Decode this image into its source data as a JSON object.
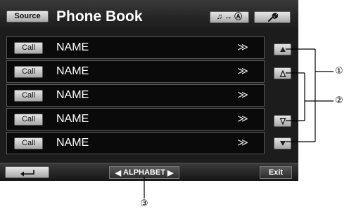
{
  "header": {
    "source_label": "Source",
    "title": "Phone Book",
    "media_label": "♫ ↔ Ⓐ",
    "setup_icon": "wrench-icon"
  },
  "contacts": [
    {
      "call_label": "Call",
      "name": "NAME",
      "more": "≫"
    },
    {
      "call_label": "Call",
      "name": "NAME",
      "more": "≫"
    },
    {
      "call_label": "Call",
      "name": "NAME",
      "more": "≫"
    },
    {
      "call_label": "Call",
      "name": "NAME",
      "more": "≫"
    },
    {
      "call_label": "Call",
      "name": "NAME",
      "more": "≫"
    }
  ],
  "scroll_buttons": {
    "page_up": "page-up-icon",
    "line_up": "line-up-icon",
    "line_down": "line-down-icon",
    "page_down": "page-down-icon"
  },
  "footer": {
    "back_icon": "back-arrow-icon",
    "alphabet_label": "ALPHABET",
    "exit_label": "Exit"
  },
  "callouts": [
    "①",
    "②",
    "③"
  ]
}
